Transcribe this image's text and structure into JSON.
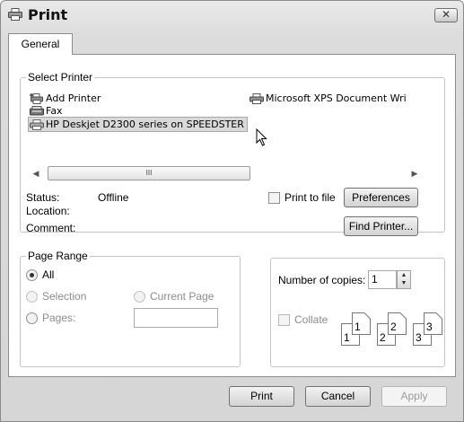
{
  "window": {
    "title": "Print",
    "close_label": "✕"
  },
  "tabs": [
    {
      "label": "General"
    }
  ],
  "select_printer": {
    "legend": "Select Printer",
    "printers": [
      {
        "name": "Add Printer",
        "icon": "add-printer-icon"
      },
      {
        "name": "Microsoft XPS Document Wri",
        "icon": "printer-icon"
      },
      {
        "name": "Fax",
        "icon": "fax-icon"
      },
      {
        "name": "HP Deskjet D2300 series on SPEEDSTER",
        "icon": "network-printer-icon",
        "selected": true
      }
    ],
    "scroll_thumb_glyph": "III",
    "status_label": "Status:",
    "status_value": "Offline",
    "location_label": "Location:",
    "location_value": "",
    "comment_label": "Comment:",
    "comment_value": "",
    "print_to_file_label": "Print to file",
    "print_to_file_checked": false,
    "preferences_label": "Preferences",
    "find_printer_label": "Find Printer..."
  },
  "page_range": {
    "legend": "Page Range",
    "all_label": "All",
    "selection_label": "Selection",
    "current_page_label": "Current Page",
    "pages_label": "Pages:",
    "pages_value": "",
    "selected_option": "All"
  },
  "copies": {
    "label": "Number of copies:",
    "value": "1",
    "collate_label": "Collate",
    "collate_checked": false,
    "collate_pages": [
      "1",
      "1",
      "2",
      "2",
      "3",
      "3"
    ]
  },
  "footer": {
    "print_label": "Print",
    "cancel_label": "Cancel",
    "apply_label": "Apply"
  },
  "colors": {
    "selection_bg": "#d9d9d9",
    "window_bg": "#dcdcdc"
  }
}
